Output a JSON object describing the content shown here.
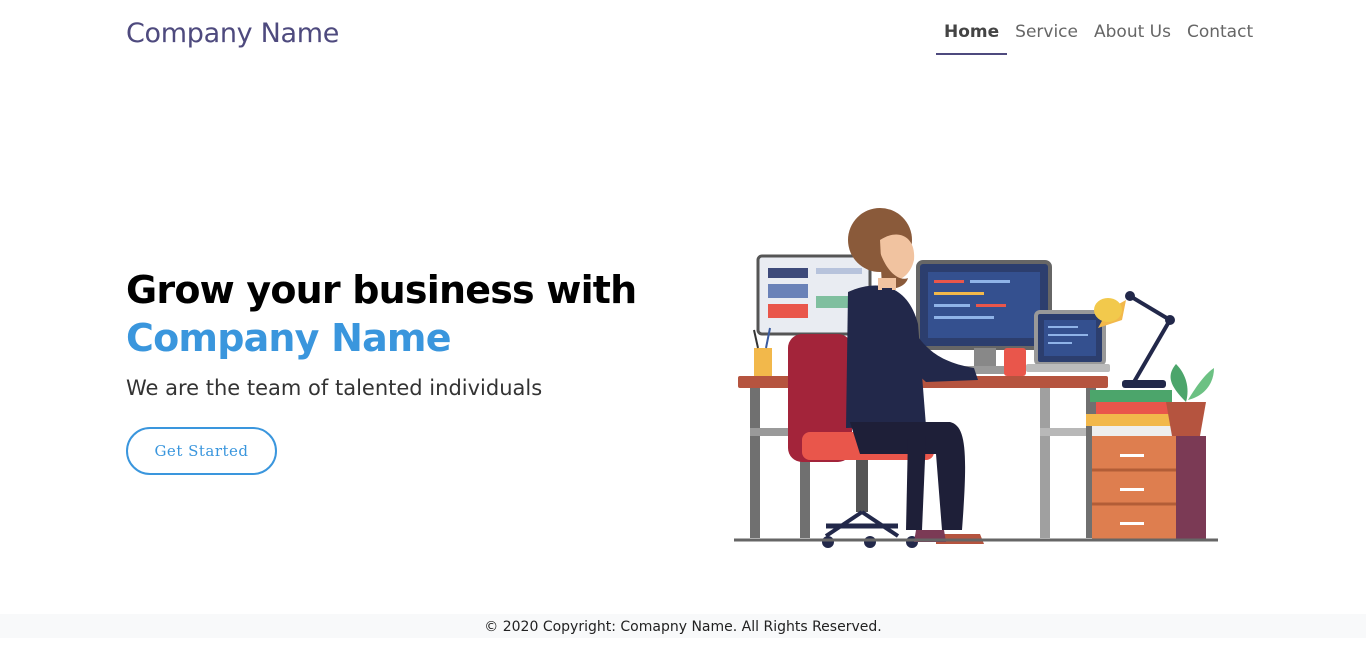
{
  "header": {
    "brand": "Company Name",
    "nav": [
      "Home",
      "Service",
      "About Us",
      "Contact"
    ]
  },
  "hero": {
    "title_line1": "Grow your business with",
    "title_line2": "Company Name",
    "tagline": "We are the team of talented individuals",
    "cta_label": "Get Started",
    "illustration": "developer-at-desk-illustration"
  },
  "footer": {
    "copyright": "© 2020 Copyright: Comapny Name. All Rights Reserved."
  },
  "colors": {
    "brand": "#4e4a7e",
    "accent": "#3a96dd",
    "footer_bg": "#f8f9fa"
  }
}
